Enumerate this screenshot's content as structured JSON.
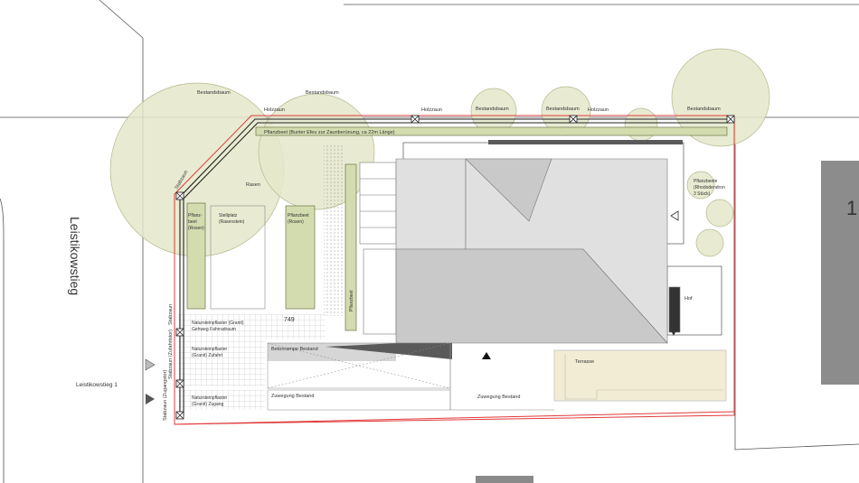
{
  "labels": {
    "street_name": "Leistikowstieg",
    "address": "Leistikowstieg 1",
    "neighbor_number": "1",
    "tree_1": "Bestandsbaum",
    "tree_2": "Bestandsbaum",
    "tree_3": "Bestandsbaum",
    "tree_4": "Bestandsbaum",
    "tree_5": "Bestandsbaum",
    "fence_wood_1": "Holzzaun",
    "fence_wood_2": "Holzzaun",
    "fence_wood_3": "Holzzaun",
    "fence_steel_top": "Stabzaun",
    "fence_steel_mid": "Stabzaun",
    "fence_steel_entry": "Stabzaun (Zufahrtstor)",
    "fence_steel_access": "Stabzaun (Zugangstor)",
    "flowerbed_long": "Pflanzbeet (Bunter Efeu zur Zaunberünung, ca 22m Länge)",
    "lawn": "Rasen",
    "flowerbed_left_1": "Pflanz-",
    "flowerbed_left_2": "beet",
    "flowerbed_left_3": "(Rosen)",
    "parking_1": "Stellplatz",
    "parking_2": "(Rasenstein)",
    "flowerbed_mid_1": "Pflanzbeet",
    "flowerbed_mid_2": "(Rosen)",
    "flowerbed_vertical": "Pflanzbeet",
    "plants_right_1": "Pflanzbeete",
    "plants_right_2": "(Rhododendron",
    "plants_right_3": "3 Stück)",
    "paving_bike_1": "Natursteinpflaster (Granit)",
    "paving_bike_2": "Gehweg Fahrradraum",
    "elevation_mark": "749",
    "paving_entry_1": "Natursteinpflaster",
    "paving_entry_2": "(Granit) Zufahrt",
    "paving_access_1": "Natursteinpflaster",
    "paving_access_2": "(Granit) Zugang",
    "ramp": "Betonrampe Bestand",
    "path_left": "Zuwegung Bestand",
    "path_right": "Zuwegung Bestand",
    "terrace": "Terrasse",
    "courtyard": "Hof"
  },
  "colors": {
    "tree_fill": "#e4e7c9",
    "tree_stroke": "#b5b98e",
    "bed_fill": "#d3dcae",
    "bed_stroke": "#6b744a",
    "terrace_fill": "#f2ecd4",
    "roof_light": "#e0e0e0",
    "roof_dark": "#c9c9c9",
    "property_line": "#e03a3a",
    "line": "#555555",
    "elevation": "#3aa63a"
  }
}
